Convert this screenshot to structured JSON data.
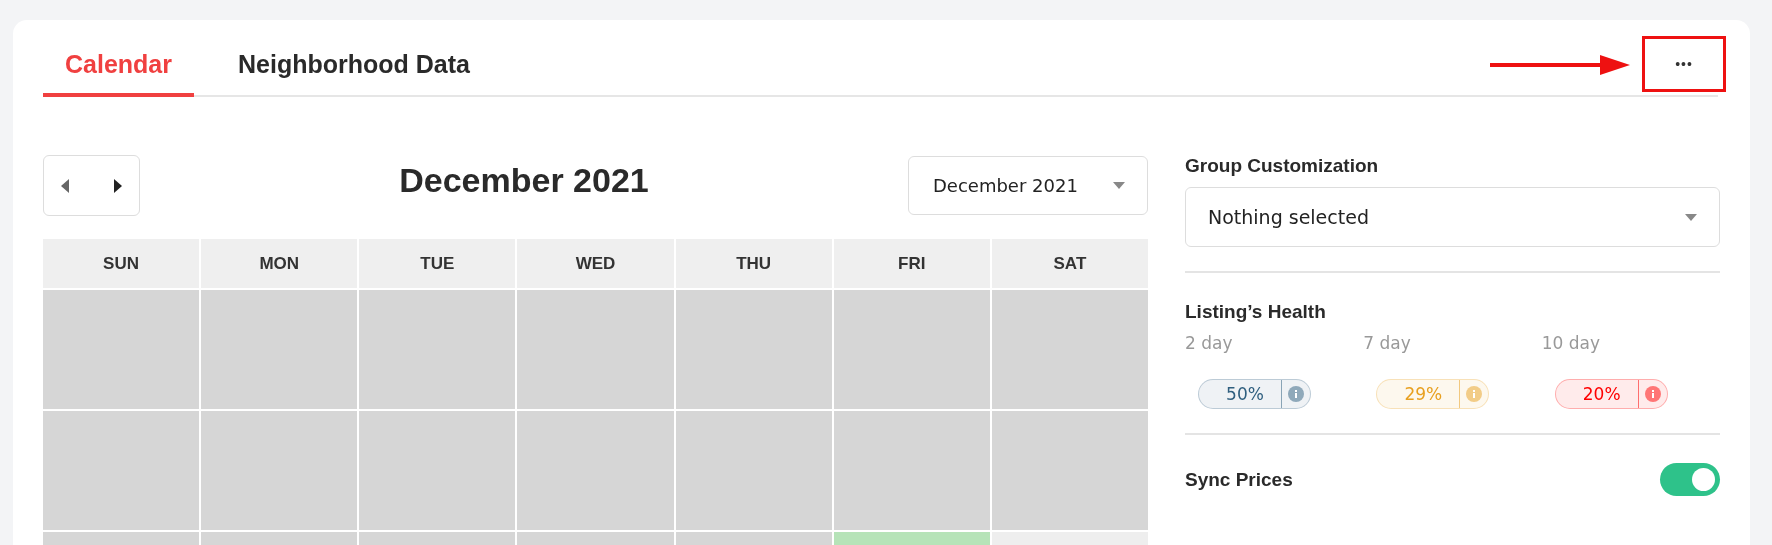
{
  "tabs": [
    {
      "label": "Calendar",
      "selected": true
    },
    {
      "label": "Neighborhood Data",
      "selected": false
    }
  ],
  "more_button": {
    "label": "•••",
    "highlighted": true
  },
  "calendar": {
    "title": "December 2021",
    "month_select": {
      "value": "December 2021"
    },
    "weekdays": [
      "SUN",
      "MON",
      "TUE",
      "WED",
      "THU",
      "FRI",
      "SAT"
    ],
    "weeks": [
      [
        {
          "kind": "past"
        },
        {
          "kind": "past"
        },
        {
          "kind": "past"
        },
        {
          "kind": "past"
        },
        {
          "kind": "past"
        },
        {
          "kind": "past"
        },
        {
          "kind": "past"
        }
      ],
      [
        {
          "kind": "past"
        },
        {
          "kind": "past"
        },
        {
          "kind": "past"
        },
        {
          "kind": "past"
        },
        {
          "kind": "past"
        },
        {
          "kind": "past"
        },
        {
          "kind": "past"
        }
      ],
      [
        {
          "kind": "past"
        },
        {
          "kind": "past"
        },
        {
          "kind": "past"
        },
        {
          "kind": "past"
        },
        {
          "kind": "past"
        },
        {
          "kind": "available"
        },
        {
          "kind": "open"
        }
      ]
    ]
  },
  "group_customization": {
    "label": "Group Customization",
    "placeholder": "Nothing selected"
  },
  "listings_health": {
    "title": "Listing’s Health",
    "items": [
      {
        "period": "2 day",
        "value": "50%",
        "color": "#2f5f7f"
      },
      {
        "period": "7 day",
        "value": "29%",
        "color": "#e8a020"
      },
      {
        "period": "10 day",
        "value": "20%",
        "color": "#ff0000"
      }
    ]
  },
  "sync_prices": {
    "label": "Sync Prices",
    "on": true
  }
}
